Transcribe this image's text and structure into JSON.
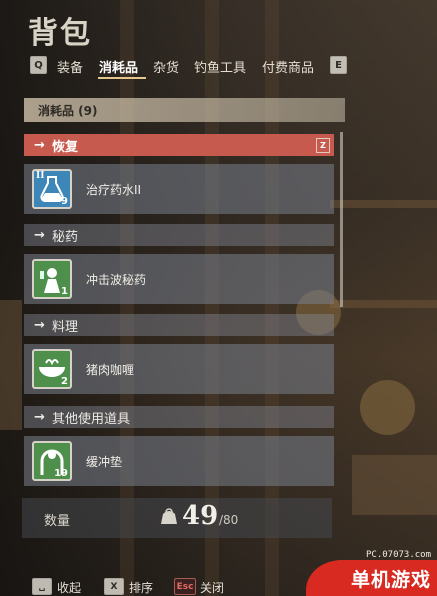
{
  "header": {
    "title": "背包"
  },
  "tabs": {
    "prev_key": "Q",
    "next_key": "E",
    "items": [
      {
        "label": "装备",
        "active": false
      },
      {
        "label": "消耗品",
        "active": true
      },
      {
        "label": "杂货",
        "active": false
      },
      {
        "label": "钓鱼工具",
        "active": false
      },
      {
        "label": "付费商品",
        "active": false
      }
    ]
  },
  "panel": {
    "header": "消耗品 (9)",
    "sections": [
      {
        "arrow": "→",
        "label": "恢复",
        "key": "Z",
        "active": true,
        "items": [
          {
            "name": "治疗药水II",
            "count": "9",
            "tier": "II",
            "icon": "potion-icon"
          }
        ]
      },
      {
        "arrow": "→",
        "label": "秘药",
        "active": false,
        "items": [
          {
            "name": "冲击波秘药",
            "count": "1",
            "icon": "elixir-icon"
          }
        ]
      },
      {
        "arrow": "→",
        "label": "料理",
        "active": false,
        "items": [
          {
            "name": "猪肉咖喱",
            "count": "2",
            "icon": "dish-icon"
          }
        ]
      },
      {
        "arrow": "→",
        "label": "其他使用道具",
        "active": false,
        "items": [
          {
            "name": "缓冲垫",
            "count": "19",
            "icon": "cushion-icon"
          }
        ]
      }
    ]
  },
  "quantity": {
    "label": "数量",
    "value": "49",
    "max": "/80",
    "icon": "bag-icon"
  },
  "footer": [
    {
      "key": "␣",
      "label": "收起"
    },
    {
      "key": "X",
      "label": "排序"
    },
    {
      "key": "Esc",
      "label": "关闭"
    }
  ],
  "watermark": {
    "url": "PC.07073.com",
    "text": "单机游戏"
  },
  "colors": {
    "active_section": "#c75a4e",
    "tab_underline": "#e6c98a",
    "watermark": "#d92a21"
  }
}
